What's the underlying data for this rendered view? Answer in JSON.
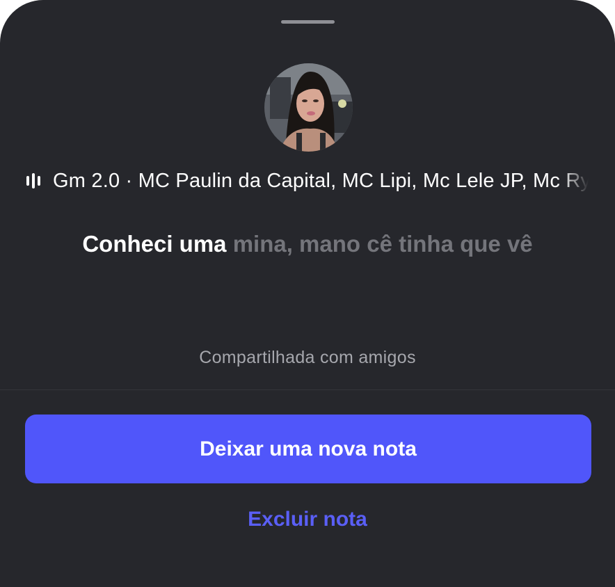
{
  "note_sheet": {
    "song": {
      "title": "Gm 2.0",
      "artists": "MC Paulin da Capital, MC Lipi, Mc Lele JP, Mc Ryan SP",
      "separator": " · "
    },
    "note": {
      "text_highlighted": "Conheci uma",
      "text_remaining": " mina, mano cê tinha que vê"
    },
    "audience_label": "Compartilhada com amigos",
    "primary_button_label": "Deixar uma nova nota",
    "secondary_button_label": "Excluir nota"
  },
  "icons": {
    "grabber": "drag-handle-icon",
    "playing": "equalizer-icon",
    "avatar": "profile-photo"
  },
  "colors": {
    "sheet_background": "#26272c",
    "accent": "#5056fa",
    "link": "#5a5ff6",
    "muted_lyric": "#74757b",
    "secondary_text": "#a6a7ad"
  }
}
